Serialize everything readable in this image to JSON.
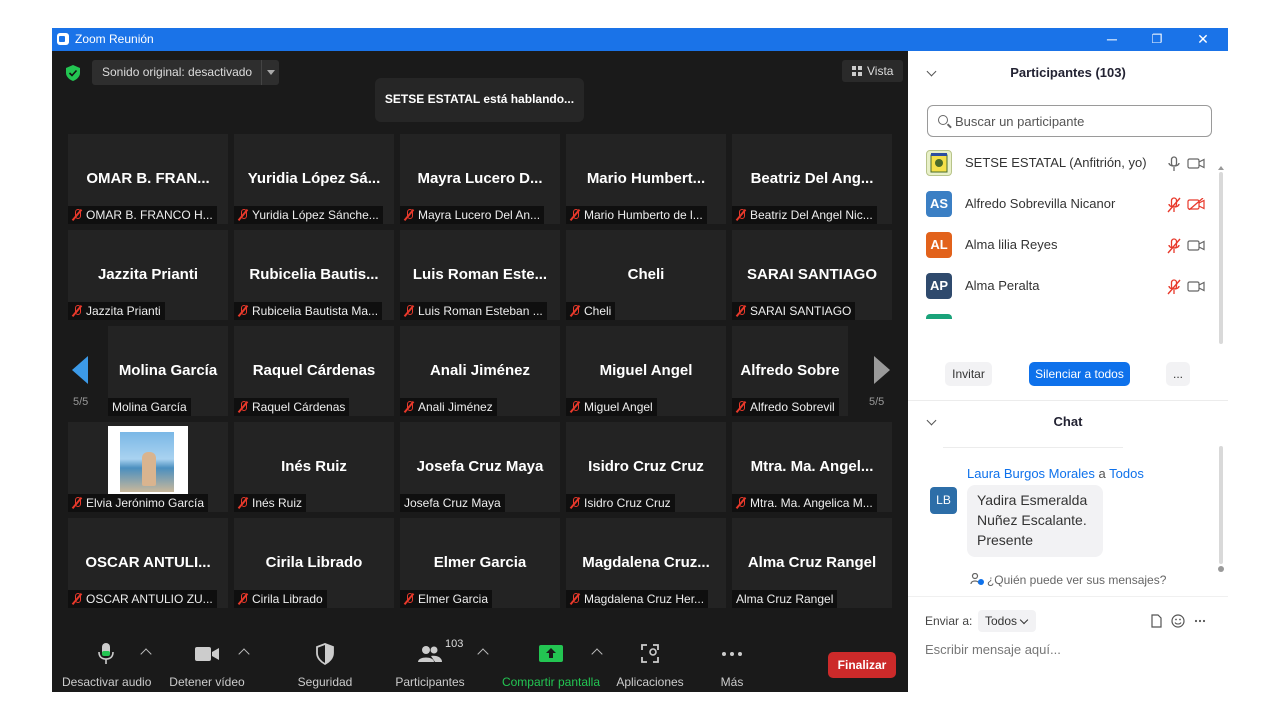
{
  "window": {
    "title": "Zoom Reunión",
    "minimize": "─",
    "restore": "❐",
    "close": "✕"
  },
  "top": {
    "audio_status": "Sonido original: desactivado",
    "speaking": "SETSE ESTATAL está hablando...",
    "view_label": "Vista"
  },
  "pager": {
    "left": "5/5",
    "right": "5/5"
  },
  "tiles": [
    {
      "big": "OMAR B. FRAN...",
      "label": "OMAR B. FRANCO H...",
      "muted": true
    },
    {
      "big": "Yuridia López Sá...",
      "label": "Yuridia López Sánche...",
      "muted": true
    },
    {
      "big": "Mayra Lucero D...",
      "label": "Mayra Lucero Del An...",
      "muted": true
    },
    {
      "big": "Mario Humbert...",
      "label": "Mario Humberto de l...",
      "muted": true
    },
    {
      "big": "Beatriz Del Ang...",
      "label": "Beatriz Del Angel Nic...",
      "muted": true
    },
    {
      "big": "Jazzita Prianti",
      "label": "Jazzita Prianti",
      "muted": true
    },
    {
      "big": "Rubicelia Bautis...",
      "label": "Rubicelia Bautista Ma...",
      "muted": true
    },
    {
      "big": "Luis Roman Este...",
      "label": "Luis Roman Esteban ...",
      "muted": true
    },
    {
      "big": "Cheli",
      "label": "Cheli",
      "muted": true
    },
    {
      "big": "SARAI SANTIAGO",
      "label": "SARAI SANTIAGO",
      "muted": true
    },
    {
      "big": "Molina García",
      "label": "Molina García",
      "muted": false
    },
    {
      "big": "Raquel Cárdenas",
      "label": "Raquel Cárdenas",
      "muted": true
    },
    {
      "big": "Anali Jiménez",
      "label": "Anali Jiménez",
      "muted": true
    },
    {
      "big": "Miguel Angel",
      "label": "Miguel Angel",
      "muted": true
    },
    {
      "big": "Alfredo Sobre",
      "label": "Alfredo Sobrevil",
      "muted": true
    },
    {
      "big": "",
      "label": "Elvia Jerónimo García",
      "muted": true
    },
    {
      "big": "Inés Ruiz",
      "label": "Inés Ruiz",
      "muted": true
    },
    {
      "big": "Josefa Cruz Maya",
      "label": "Josefa Cruz Maya",
      "muted": false
    },
    {
      "big": "Isidro Cruz Cruz",
      "label": "Isidro Cruz Cruz",
      "muted": true
    },
    {
      "big": "Mtra. Ma. Angel...",
      "label": "Mtra. Ma. Angelica M...",
      "muted": true
    },
    {
      "big": "OSCAR ANTULI...",
      "label": "OSCAR ANTULIO ZU...",
      "muted": true
    },
    {
      "big": "Cirila Librado",
      "label": "Cirila Librado",
      "muted": true
    },
    {
      "big": "Elmer Garcia",
      "label": "Elmer Garcia",
      "muted": true
    },
    {
      "big": "Magdalena Cruz...",
      "label": "Magdalena Cruz Her...",
      "muted": true
    },
    {
      "big": "Alma Cruz Rangel",
      "label": "Alma Cruz Rangel",
      "muted": false
    }
  ],
  "toolbar": {
    "audio": "Desactivar audio",
    "video": "Detener vídeo",
    "security": "Seguridad",
    "participants": "Participantes",
    "participants_count": "103",
    "share": "Compartir pantalla",
    "apps": "Aplicaciones",
    "more": "Más",
    "end": "Finalizar"
  },
  "participants_panel": {
    "title": "Participantes (103)",
    "search_placeholder": "Buscar un participante",
    "list": [
      {
        "initials": "",
        "name": "SETSE ESTATAL (Anfitrión, yo)",
        "color": "#e8f0c8",
        "mic_muted": false,
        "cam_off": false
      },
      {
        "initials": "AS",
        "name": "Alfredo Sobrevilla Nicanor",
        "color": "#3b7fc4",
        "mic_muted": true,
        "cam_off": true
      },
      {
        "initials": "AL",
        "name": "Alma lilia Reyes",
        "color": "#e2621b",
        "mic_muted": true,
        "cam_off": false
      },
      {
        "initials": "AP",
        "name": "Alma Peralta",
        "color": "#2f4a6d",
        "mic_muted": true,
        "cam_off": false
      },
      {
        "initials": "",
        "name": "",
        "color": "#1aa37a",
        "mic_muted": true,
        "cam_off": true
      }
    ],
    "invite": "Invitar",
    "mute_all": "Silenciar a todos",
    "more": "..."
  },
  "chat": {
    "title": "Chat",
    "sender": "Laura Burgos Morales",
    "to_word": "a",
    "recipient": "Todos",
    "avatar": "LB",
    "message_lines": [
      "Yadira Esmeralda",
      "Nuñez Escalante.",
      "Presente"
    ],
    "who_sees": "¿Quién puede ver sus mensajes?",
    "send_to_label": "Enviar a:",
    "send_to_value": "Todos",
    "input_placeholder": "Escribir mensaje aquí..."
  },
  "colors": {
    "accent": "#0e71eb",
    "end": "#cc2a2a",
    "share": "#23c552",
    "muted": "#e8392b"
  }
}
